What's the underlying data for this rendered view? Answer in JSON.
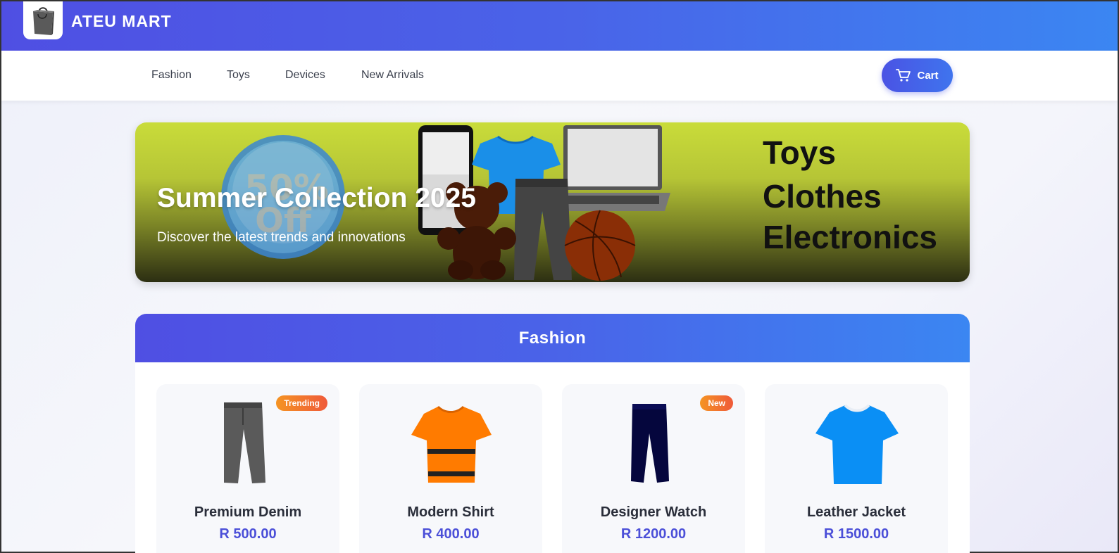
{
  "header": {
    "brand": "ATEU MART"
  },
  "nav": {
    "links": [
      "Fashion",
      "Toys",
      "Devices",
      "New Arrivals"
    ],
    "cart_label": "Cart"
  },
  "hero": {
    "title": "Summer Collection 2025",
    "subtitle": "Discover the latest trends and innovations",
    "discount_text": [
      "50%",
      "Off"
    ],
    "categories": [
      "Toys",
      "Clothes",
      "Electronics"
    ]
  },
  "fashion": {
    "heading": "Fashion",
    "products": [
      {
        "name": "Premium Denim",
        "price": "R 500.00",
        "badge": "Trending",
        "icon": "jeans-icon"
      },
      {
        "name": "Modern Shirt",
        "price": "R 400.00",
        "badge": "",
        "icon": "orange-shirt-icon"
      },
      {
        "name": "Designer Watch",
        "price": "R 1200.00",
        "badge": "New",
        "icon": "navy-pants-icon"
      },
      {
        "name": "Leather Jacket",
        "price": "R 1500.00",
        "badge": "",
        "icon": "blue-tshirt-icon"
      }
    ]
  },
  "colors": {
    "primary": "#4f4fe3",
    "accent": "#3b86f2",
    "price": "#4b4fd8",
    "badge": "#f5822d"
  }
}
